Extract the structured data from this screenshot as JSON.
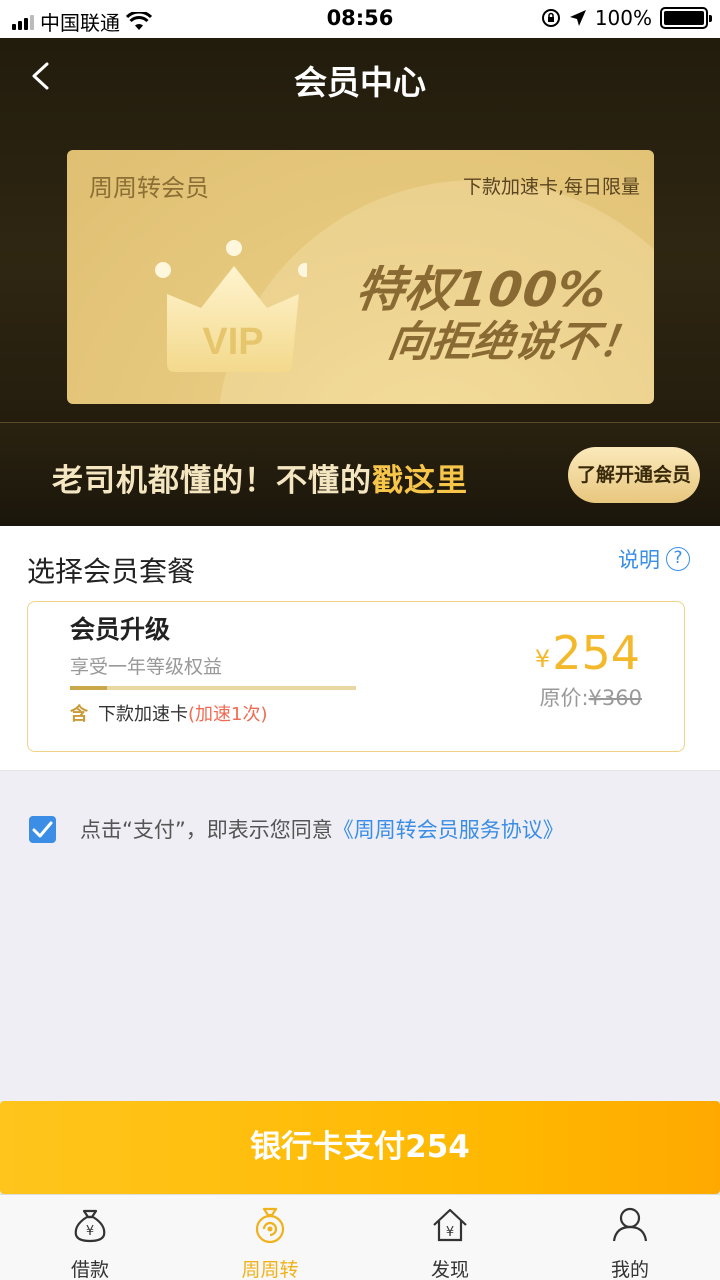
{
  "status_bar": {
    "carrier": "中国联通",
    "time": "08:56",
    "battery": "100%"
  },
  "header": {
    "title": "会员中心"
  },
  "vip_card": {
    "brand": "周周转会员",
    "tagline": "下款加速卡,每日限量",
    "badge": "VIP",
    "slogan_line1": "特权100%",
    "slogan_line2": "向拒绝说不！"
  },
  "promo": {
    "text": "老司机都懂的！不懂的",
    "highlight": "戳这里",
    "button": "了解开通会员"
  },
  "package": {
    "title": "选择会员套餐",
    "help": "说明",
    "help_icon": "?",
    "plan": {
      "name": "会员升级",
      "desc": "享受一年等级权益",
      "progress_fraction": 0.13,
      "includes_label": "含",
      "includes_item": "下款加速卡",
      "includes_note": "(加速1次)",
      "currency": "¥",
      "price": "254",
      "orig_label": "原价:",
      "orig_price": "¥360"
    }
  },
  "agreement": {
    "checked": true,
    "text": "点击“支付”，即表示您同意",
    "link": "《周周转会员服务协议》"
  },
  "pay_button": {
    "label": "银行卡支付254"
  },
  "tabs": [
    {
      "label": "借款",
      "icon": "money-bag-icon",
      "active": false
    },
    {
      "label": "周周转",
      "icon": "cycle-coin-icon",
      "active": true
    },
    {
      "label": "发现",
      "icon": "home-yen-icon",
      "active": false
    },
    {
      "label": "我的",
      "icon": "person-icon",
      "active": false
    }
  ],
  "colors": {
    "accent": "#ffb800",
    "link": "#3a8ee6",
    "gold": "#f4b82b",
    "header_bg": "#2a2210"
  }
}
